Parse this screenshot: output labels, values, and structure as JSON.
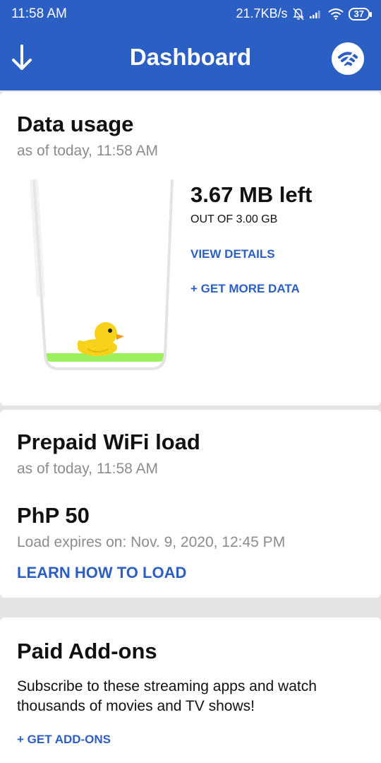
{
  "status_bar": {
    "time": "11:58 AM",
    "net_speed": "21.7KB/s",
    "battery": "37"
  },
  "app_bar": {
    "title": "Dashboard",
    "left_icon": "arrow-down-icon",
    "right_icon": "wifi-logo-icon"
  },
  "data_usage": {
    "title": "Data usage",
    "as_of": "as of today, 11:58 AM",
    "amount_left": "3.67 MB left",
    "out_of": "OUT OF 3.00 GB",
    "view_details": "VIEW DETAILS",
    "get_more": "+ GET MORE DATA",
    "illustration_icon": "duck-icon",
    "colors": {
      "water": "#9cf05e",
      "duck": "#f8d21a",
      "beak": "#ee9a10"
    }
  },
  "prepaid": {
    "title": "Prepaid WiFi load",
    "as_of": "as of today, 11:58 AM",
    "balance": "PhP 50",
    "expires": "Load expires on: Nov. 9, 2020, 12:45 PM",
    "learn_link": "LEARN HOW TO LOAD"
  },
  "addons": {
    "title": "Paid Add-ons",
    "description": "Subscribe to these streaming apps and watch thousands of movies and TV shows!",
    "get_addons": "+ GET ADD-ONS"
  },
  "colors": {
    "primary": "#2c5fc4",
    "muted_text": "#8c8c8c",
    "background": "#e4e4e4"
  }
}
